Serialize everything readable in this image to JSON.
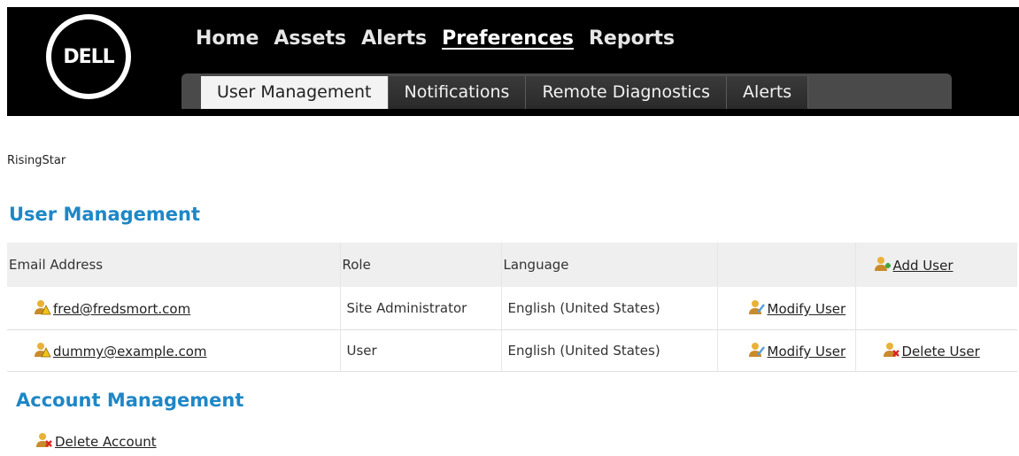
{
  "brand": {
    "logo_text": "DELL"
  },
  "topnav": [
    "Home",
    "Assets",
    "Alerts",
    "Preferences",
    "Reports"
  ],
  "subtabs": [
    "User Management",
    "Notifications",
    "Remote Diagnostics",
    "Alerts"
  ],
  "breadcrumb": "RisingStar",
  "section_title": "User Management",
  "table": {
    "columns": [
      "Email Address",
      "Role",
      "Language"
    ],
    "add_user": "Add User",
    "rows": [
      {
        "email": "fred@fredsmort.com",
        "role": "Site Administrator",
        "language": "English (United States)",
        "modify": "Modify User",
        "delete": ""
      },
      {
        "email": "dummy@example.com",
        "role": "User",
        "language": "English (United States)",
        "modify": "Modify User",
        "delete": "Delete User"
      }
    ]
  },
  "account_title": "Account Management",
  "delete_account": "Delete Account",
  "colors": {
    "accent": "#1e87c6",
    "header": "#000000"
  }
}
